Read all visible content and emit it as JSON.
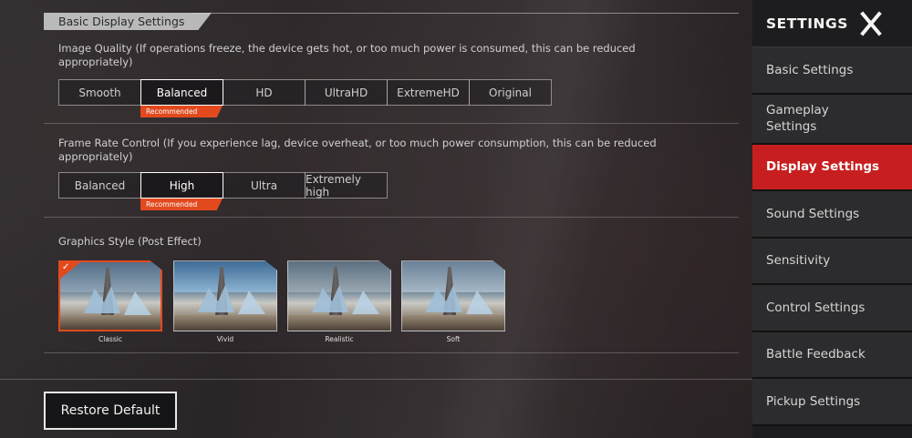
{
  "section_title": "Basic Display Settings",
  "image_quality": {
    "description": "Image Quality (If operations freeze, the device gets hot, or too much power is consumed, this can be reduced appropriately)",
    "options": [
      "Smooth",
      "Balanced",
      "HD",
      "UltraHD",
      "ExtremeHD",
      "Original"
    ],
    "selected": "Balanced",
    "recommended_tag": "Recommended"
  },
  "frame_rate": {
    "description": "Frame Rate Control (If you experience lag, device overheat, or too much power consumption, this can be reduced appropriately)",
    "options": [
      "Balanced",
      "High",
      "Ultra",
      "Extremely high"
    ],
    "selected": "High",
    "recommended_tag": "Recommended"
  },
  "graphics_style": {
    "label": "Graphics Style (Post Effect)",
    "options": [
      "Classic",
      "Vivid",
      "Realistic",
      "Soft"
    ],
    "selected": "Classic"
  },
  "restore_default": "Restore Default",
  "sidebar": {
    "title": "SETTINGS",
    "close_icon": "close-icon",
    "items": [
      {
        "label": "Basic Settings"
      },
      {
        "label": "Gameplay\nSettings"
      },
      {
        "label": "Display Settings"
      },
      {
        "label": "Sound Settings"
      },
      {
        "label": "Sensitivity"
      },
      {
        "label": "Control Settings"
      },
      {
        "label": "Battle Feedback"
      },
      {
        "label": "Pickup Settings"
      }
    ],
    "active": "Display Settings"
  },
  "colors": {
    "accent": "#e24a1e",
    "active_nav": "#c71f1f",
    "sidebar_bg": "#1d1d1f"
  }
}
